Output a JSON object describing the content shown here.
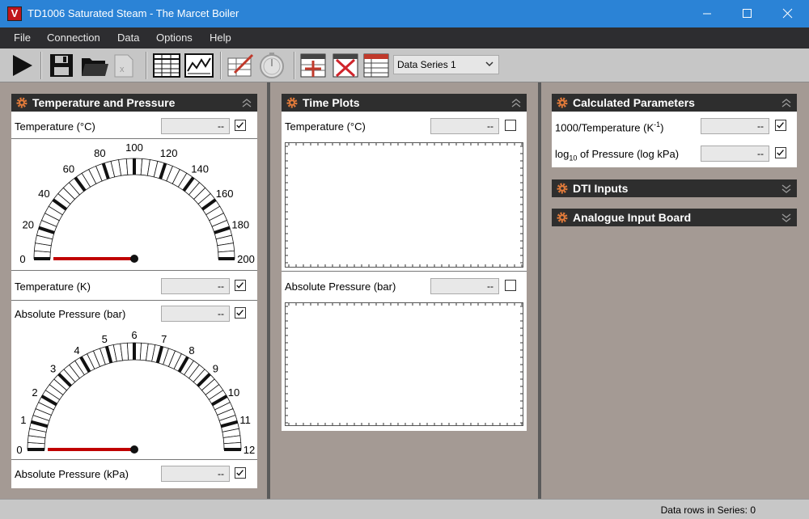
{
  "window": {
    "title": "TD1006 Saturated Steam - The Marcet Boiler",
    "icon_letter": "V"
  },
  "menu": [
    "File",
    "Connection",
    "Data",
    "Options",
    "Help"
  ],
  "toolbar": {
    "series_selected": "Data Series 1"
  },
  "panels": {
    "temp_pressure": {
      "title": "Temperature and Pressure",
      "temp_c": {
        "label": "Temperature  (°C)",
        "value": "--",
        "checked": true
      },
      "temp_gauge": {
        "ticks": [
          "0",
          "20",
          "40",
          "60",
          "80",
          "100",
          "120",
          "140",
          "160",
          "180",
          "200"
        ],
        "min": 0,
        "max": 200,
        "value": 0
      },
      "temp_k": {
        "label": "Temperature  (K)",
        "value": "--",
        "checked": true
      },
      "abs_bar": {
        "label": "Absolute Pressure  (bar)",
        "value": "--",
        "checked": true
      },
      "pressure_gauge": {
        "ticks": [
          "0",
          "1",
          "2",
          "3",
          "4",
          "5",
          "6",
          "7",
          "8",
          "9",
          "10",
          "11",
          "12"
        ],
        "min": 0,
        "max": 12,
        "value": 0
      },
      "abs_kpa": {
        "label": "Absolute Pressure  (kPa)",
        "value": "--",
        "checked": true
      }
    },
    "time_plots": {
      "title": "Time Plots",
      "temp": {
        "label": "Temperature  (°C)",
        "value": "--",
        "checked": false
      },
      "pressure": {
        "label": "Absolute Pressure  (bar)",
        "value": "--",
        "checked": false
      }
    },
    "calc": {
      "title": "Calculated Parameters",
      "inv_temp": {
        "label_main": "1000/Temperature  (K",
        "label_sup": "-1",
        "label_end": ")",
        "value": "--",
        "checked": true
      },
      "log_p": {
        "label_main": "log",
        "label_sub": "10",
        "label_end": " of Pressure  (log kPa)",
        "value": "--",
        "checked": true
      }
    },
    "dti": {
      "title": "DTI Inputs"
    },
    "aib": {
      "title": "Analogue Input Board"
    }
  },
  "status": {
    "text": "Data rows in Series: 0"
  },
  "colors": {
    "titlebar": "#2b83d6",
    "needle": "#c00000",
    "header": "#2e2e2e",
    "gear": "#e07a3a"
  }
}
